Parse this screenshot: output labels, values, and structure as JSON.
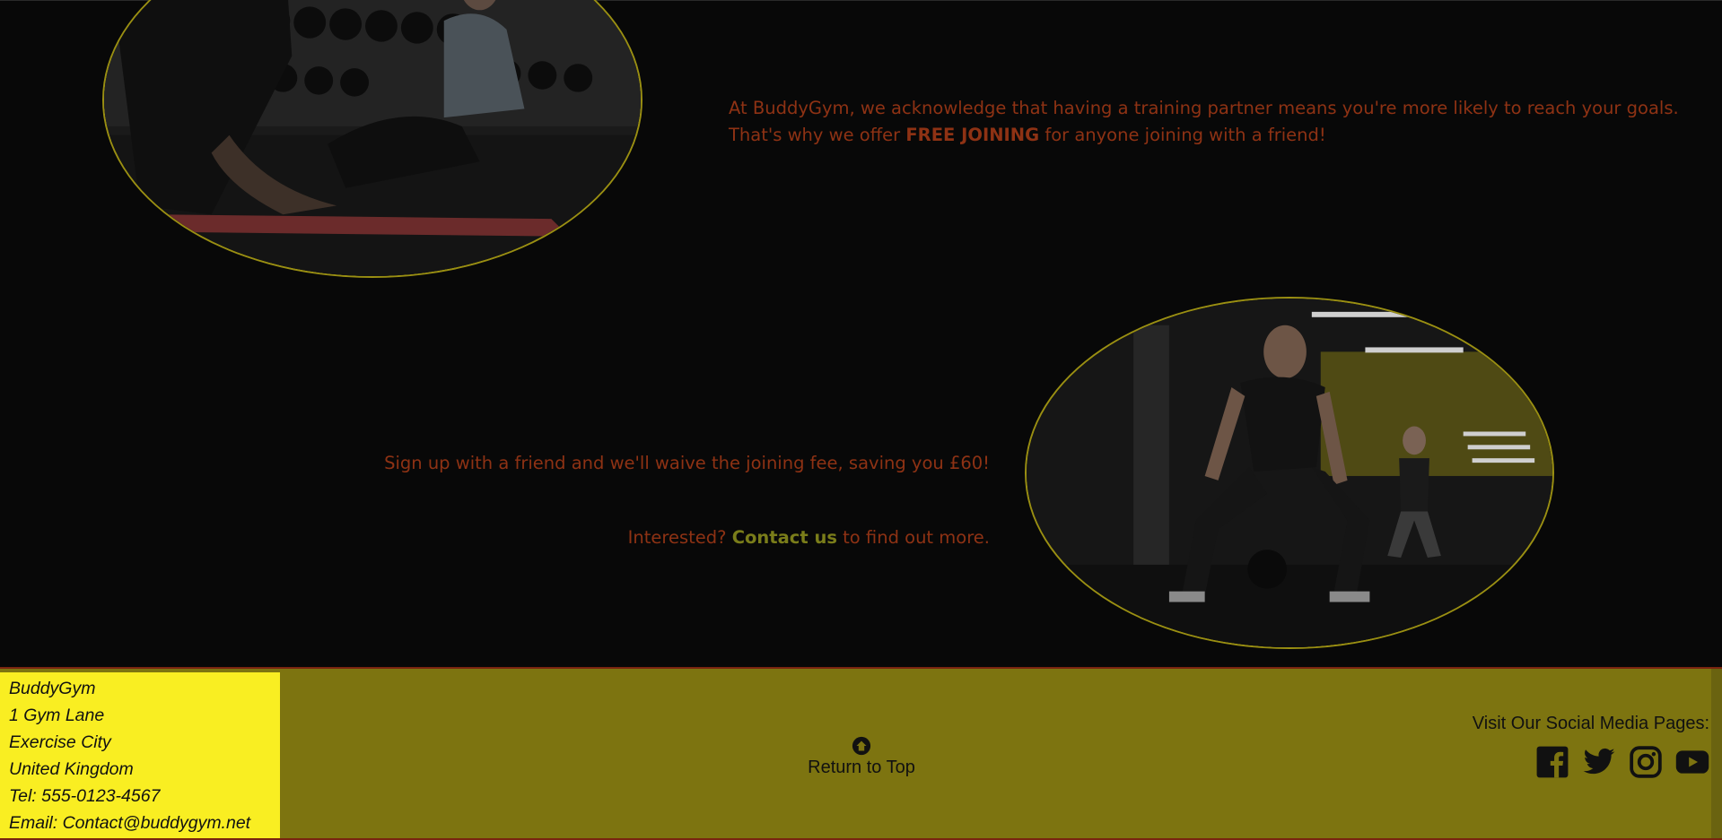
{
  "intro": {
    "text_before": "At BuddyGym, we acknowledge that having a training partner means you're more likely to reach your goals. That's why we offer ",
    "highlight": "FREE JOINING",
    "text_after": " for anyone joining with a friend!"
  },
  "signup": {
    "text": "Sign up with a friend and we'll waive the joining fee, saving you £60!"
  },
  "interest": {
    "prefix": "Interested? ",
    "link_label": "Contact us",
    "suffix": " to find out more."
  },
  "footer": {
    "address": {
      "name": "BuddyGym",
      "line1": "1 Gym Lane",
      "city": "Exercise City",
      "country": "United Kingdom",
      "tel": "Tel: 555-0123-4567",
      "email": "Email: Contact@buddygym.net"
    },
    "return_top_label": "Return to Top",
    "social_heading": "Visit Our Social Media Pages:",
    "social_icons": [
      "facebook-icon",
      "twitter-icon",
      "instagram-icon",
      "youtube-icon"
    ]
  },
  "colors": {
    "background": "#080808",
    "body_text": "#8e3214",
    "accent_border": "#9a8f12",
    "footer_bg": "#7d7410",
    "address_bg": "#f9ee22"
  }
}
